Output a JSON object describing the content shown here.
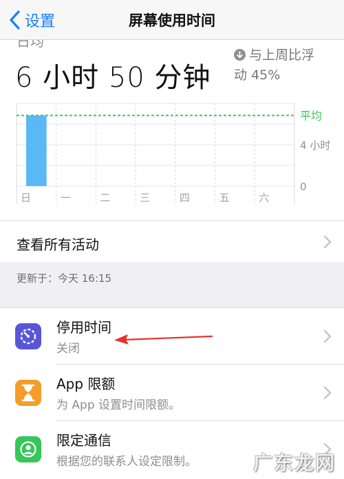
{
  "navbar": {
    "back_label": "设置",
    "title": "屏幕使用时间"
  },
  "summary": {
    "cut_label": "日均",
    "total_time": "6 小时 50 分钟",
    "compare_line1": "与上周比浮",
    "compare_line2": "动 45%"
  },
  "chart_data": {
    "type": "bar",
    "categories": [
      "日",
      "一",
      "二",
      "三",
      "四",
      "五",
      "六"
    ],
    "values": [
      6.83,
      0,
      0,
      0,
      0,
      0,
      0
    ],
    "average": 6.83,
    "ylim": [
      0,
      8
    ],
    "y_ticks": [
      {
        "value": 0,
        "label": "0"
      },
      {
        "value": 4,
        "label": "4 小时"
      }
    ],
    "average_label": "平均",
    "bar_color": "#5ab8f7",
    "average_color": "#34c759",
    "grid": true
  },
  "activity": {
    "label": "查看所有活动"
  },
  "updated": {
    "text": "更新于：今天 16:15"
  },
  "items": [
    {
      "title": "停用时间",
      "subtitle": "关闭",
      "icon": "downtime-icon",
      "color": "#5856d6"
    },
    {
      "title": "App 限额",
      "subtitle": "为 App 设置时间限额。",
      "icon": "hourglass-icon",
      "color": "#f49d2a"
    },
    {
      "title": "限定通信",
      "subtitle": "根据您的联系人设定限制。",
      "icon": "contact-icon",
      "color": "#34c759"
    }
  ],
  "annotation": {
    "color": "#e5322d"
  },
  "watermark": {
    "text": "广东龙网"
  }
}
